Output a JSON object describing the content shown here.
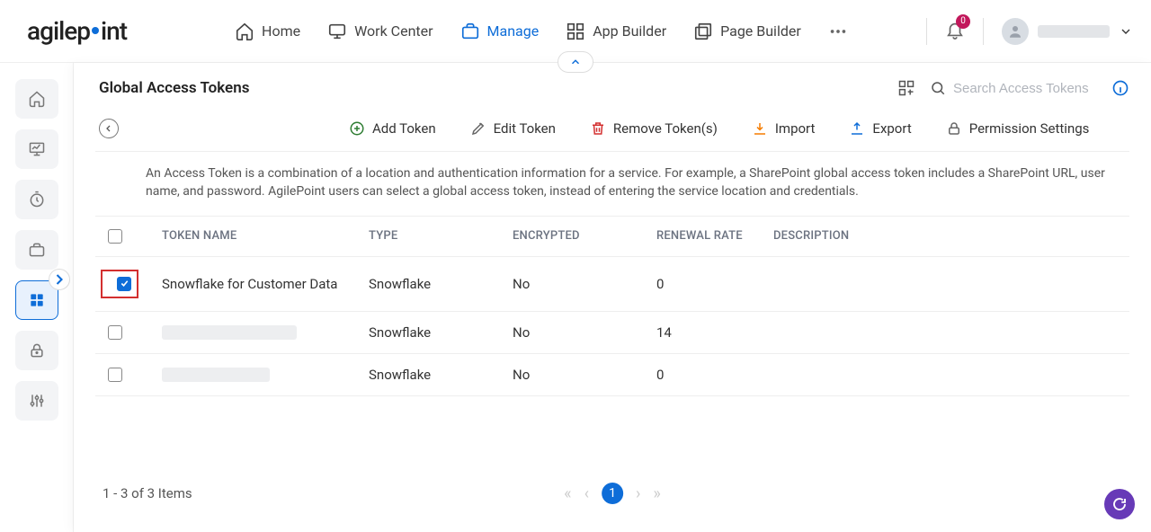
{
  "brand": {
    "name_left": "agilep",
    "name_right": "int"
  },
  "nav": {
    "items": [
      {
        "label": "Home"
      },
      {
        "label": "Work Center"
      },
      {
        "label": "Manage",
        "active": true
      },
      {
        "label": "App Builder"
      },
      {
        "label": "Page Builder"
      }
    ],
    "badge_count": "0"
  },
  "page": {
    "title": "Global Access Tokens",
    "search_placeholder": "Search Access Tokens",
    "description": "An Access Token is a combination of a location and authentication information for a service. For example, a SharePoint global access token includes a SharePoint URL, user name, and password. AgilePoint users can select a global access token, instead of entering the service location and credentials."
  },
  "toolbar": {
    "add": "Add Token",
    "edit": "Edit Token",
    "remove": "Remove Token(s)",
    "import": "Import",
    "export": "Export",
    "perm": "Permission Settings"
  },
  "table": {
    "headers": {
      "name": "TOKEN NAME",
      "type": "TYPE",
      "encrypted": "ENCRYPTED",
      "rate": "RENEWAL RATE",
      "desc": "DESCRIPTION"
    },
    "rows": [
      {
        "checked": true,
        "highlighted": true,
        "name": "Snowflake for Customer Data",
        "type": "Snowflake",
        "encrypted": "No",
        "rate": "0",
        "desc": ""
      },
      {
        "checked": false,
        "name": "",
        "redacted": true,
        "type": "Snowflake",
        "encrypted": "No",
        "rate": "14",
        "desc": ""
      },
      {
        "checked": false,
        "name": "",
        "redacted": true,
        "small": true,
        "type": "Snowflake",
        "encrypted": "No",
        "rate": "0",
        "desc": ""
      }
    ]
  },
  "footer": {
    "status": "1 - 3 of 3 Items",
    "page": "1"
  }
}
